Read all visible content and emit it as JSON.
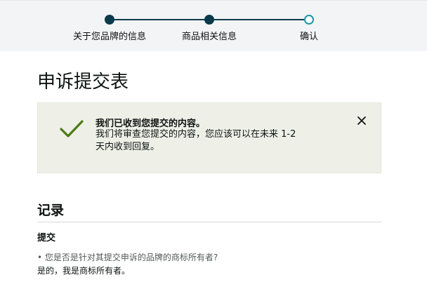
{
  "stepper": {
    "steps": [
      {
        "label": "关于您品牌的信息",
        "state": "done"
      },
      {
        "label": "商品相关信息",
        "state": "done"
      },
      {
        "label": "确认",
        "state": "current"
      }
    ]
  },
  "page": {
    "title": "申诉提交表"
  },
  "alert": {
    "title": "我们已收到您提交的内容。",
    "body": "我们将审查您提交的内容，您应该可以在未来 1-2 天内收到回复。",
    "icon": "check-icon",
    "close_icon": "close-icon",
    "accent_color": "#4c7a12"
  },
  "record": {
    "title": "记录",
    "subtitle": "提交",
    "question": "• 您是否是针对其提交申诉的品牌的商标所有者?",
    "answer": "是的，我是商标所有者。"
  }
}
